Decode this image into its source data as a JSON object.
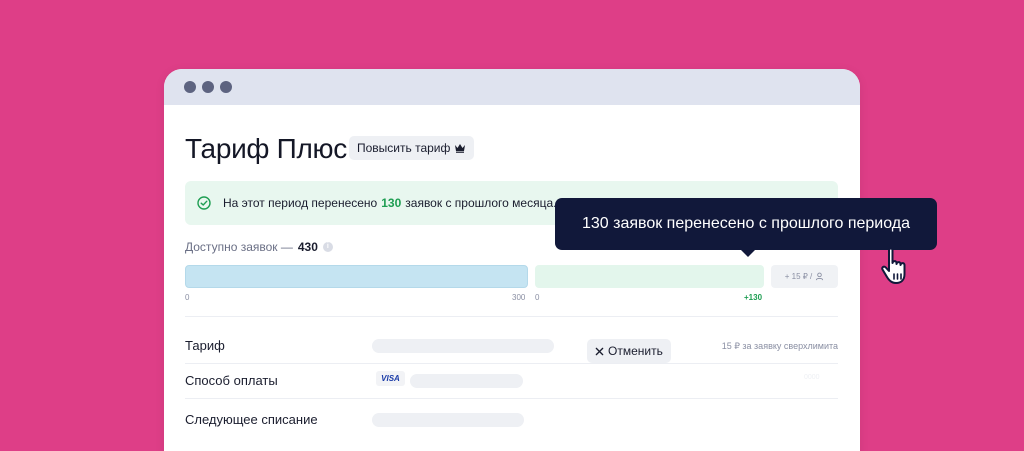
{
  "window": {
    "title": "Тариф Плюс",
    "upgrade_label": "Повысить тариф"
  },
  "notice": {
    "prefix": "На этот период перенесено",
    "count": "130",
    "suffix": "заявок с прошлого месяца."
  },
  "available": {
    "label": "Доступно заявок —",
    "count": "430",
    "info_icon": "i"
  },
  "progress": {
    "base_min": "0",
    "base_max": "300",
    "carried_min": "0",
    "carried_value": "+130",
    "extra_label": "+ 15 ₽ /"
  },
  "rows": {
    "tariff_label": "Тариф",
    "tariff_note": "15 ₽ за заявку сверхлимита",
    "payment_label": "Способ оплаты",
    "payment_card": "VISA",
    "payment_ghost": "0000",
    "next_charge_label": "Следующее списание",
    "cancel_label": "Отменить"
  },
  "tooltip": {
    "text": "130 заявок перенесено с прошлого периода"
  },
  "colors": {
    "background": "#de3e87",
    "titlebar": "#dfe3ef",
    "tooltip": "#11183a",
    "accent_green": "#1e9e52",
    "bar_blue": "#c5e4f2",
    "bar_green": "#e3f6ec"
  },
  "icons": [
    "check-circle-icon",
    "crown-icon",
    "info-icon",
    "user-icon",
    "close-icon",
    "hand-pointer-icon"
  ]
}
